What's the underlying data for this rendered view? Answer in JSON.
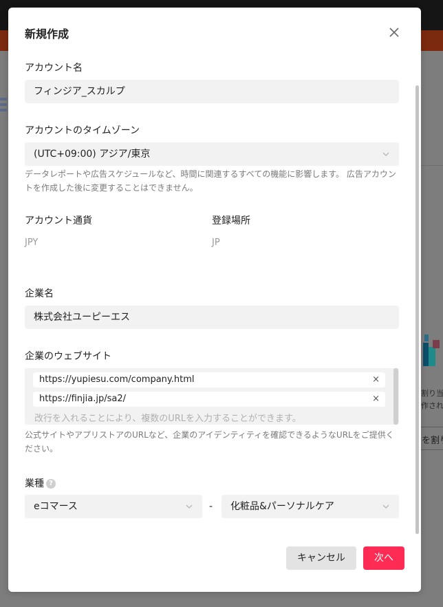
{
  "modal": {
    "title": "新規作成",
    "account_name": {
      "label": "アカウント名",
      "value": "フィンジア_スカルプ"
    },
    "timezone": {
      "label": "アカウントのタイムゾーン",
      "value": "(UTC+09:00) アジア/東京",
      "help": "データレポートや広告スケジュールなど、時間に関連するすべての機能に影響します。 広告アカウントを作成した後に変更することはできません。"
    },
    "currency": {
      "label": "アカウント通貨",
      "value": "JPY"
    },
    "location": {
      "label": "登録場所",
      "value": "JP"
    },
    "company": {
      "label": "企業名",
      "value": "株式会社ユーピーエス"
    },
    "website": {
      "label": "企業のウェブサイト",
      "urls": [
        "https://yupiesu.com/company.html",
        "https://finjia.jp/sa2/"
      ],
      "placeholder": "改行を入れることにより、複数のURLを入力することができます。",
      "help": "公式サイトやアプリストアのURLなど、企業のアイデンティティを確認できるようなURLをご提供ください。",
      "remove_symbol": "×"
    },
    "industry": {
      "label": "業種",
      "primary": "eコマース",
      "separator": "-",
      "secondary": "化粧品&パーソナルケア"
    },
    "buttons": {
      "cancel": "キャンセル",
      "next": "次へ"
    }
  },
  "background": {
    "right_text_1": "割り当",
    "right_text_2": "作され",
    "right_button": "を割り"
  },
  "colors": {
    "primary": "#fe2c55",
    "field_bg": "#f2f2f2",
    "overlay": "#7d7d7d"
  }
}
